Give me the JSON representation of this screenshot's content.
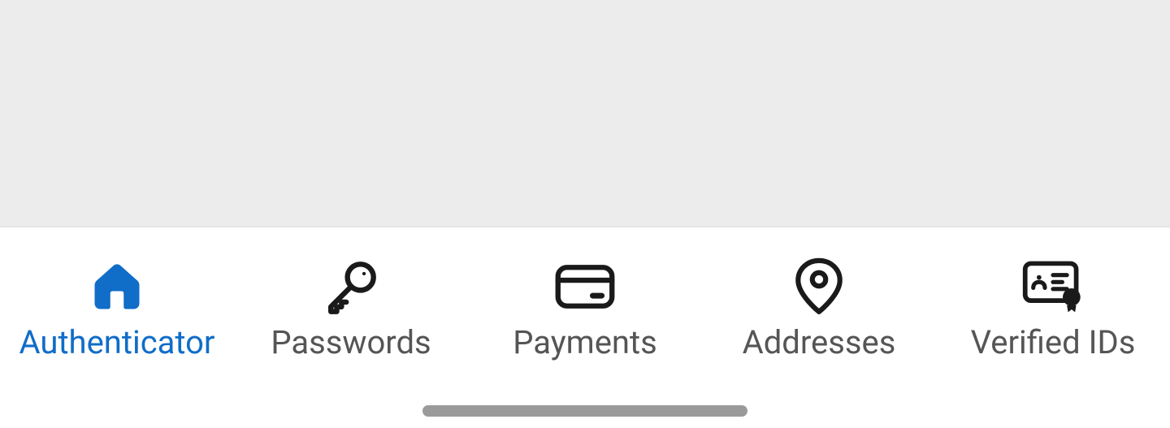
{
  "colors": {
    "active": "#106dc8",
    "inactive": "#222222",
    "label_inactive": "#555555"
  },
  "nav": {
    "items": [
      {
        "label": "Authenticator",
        "icon": "home",
        "active": true
      },
      {
        "label": "Passwords",
        "icon": "key",
        "active": false
      },
      {
        "label": "Payments",
        "icon": "card",
        "active": false
      },
      {
        "label": "Addresses",
        "icon": "location",
        "active": false
      },
      {
        "label": "Verified IDs",
        "icon": "id-badge",
        "active": false
      }
    ]
  }
}
